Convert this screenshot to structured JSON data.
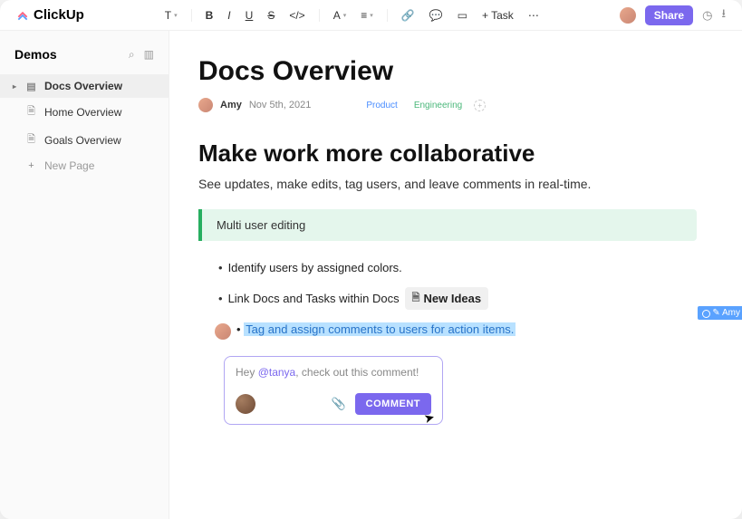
{
  "brand": {
    "name": "ClickUp"
  },
  "toolbar": {
    "task_label": "+ Task",
    "share": "Share"
  },
  "sidebar": {
    "title": "Demos",
    "items": [
      {
        "label": "Docs Overview",
        "active": true
      },
      {
        "label": "Home Overview",
        "active": false
      },
      {
        "label": "Goals Overview",
        "active": false
      }
    ],
    "new_page": "New Page"
  },
  "doc": {
    "title": "Docs Overview",
    "author": "Amy",
    "date": "Nov 5th, 2021",
    "tags": {
      "product": "Product",
      "engineering": "Engineering"
    }
  },
  "section": {
    "heading": "Make work more collaborative",
    "sub": "See updates, make edits, tag users, and leave comments in real-time.",
    "callout": "Multi user editing",
    "bullets": {
      "b1": "Identify users by assigned colors.",
      "b2": "Link Docs and Tasks within Docs",
      "b2_chip": "New Ideas",
      "b3": "Tag and assign comments to users for action items."
    },
    "presence_user": "Amy"
  },
  "comment": {
    "prefix": "Hey ",
    "mention": "@tanya",
    "suffix": ", check out this comment!",
    "button": "COMMENT"
  }
}
